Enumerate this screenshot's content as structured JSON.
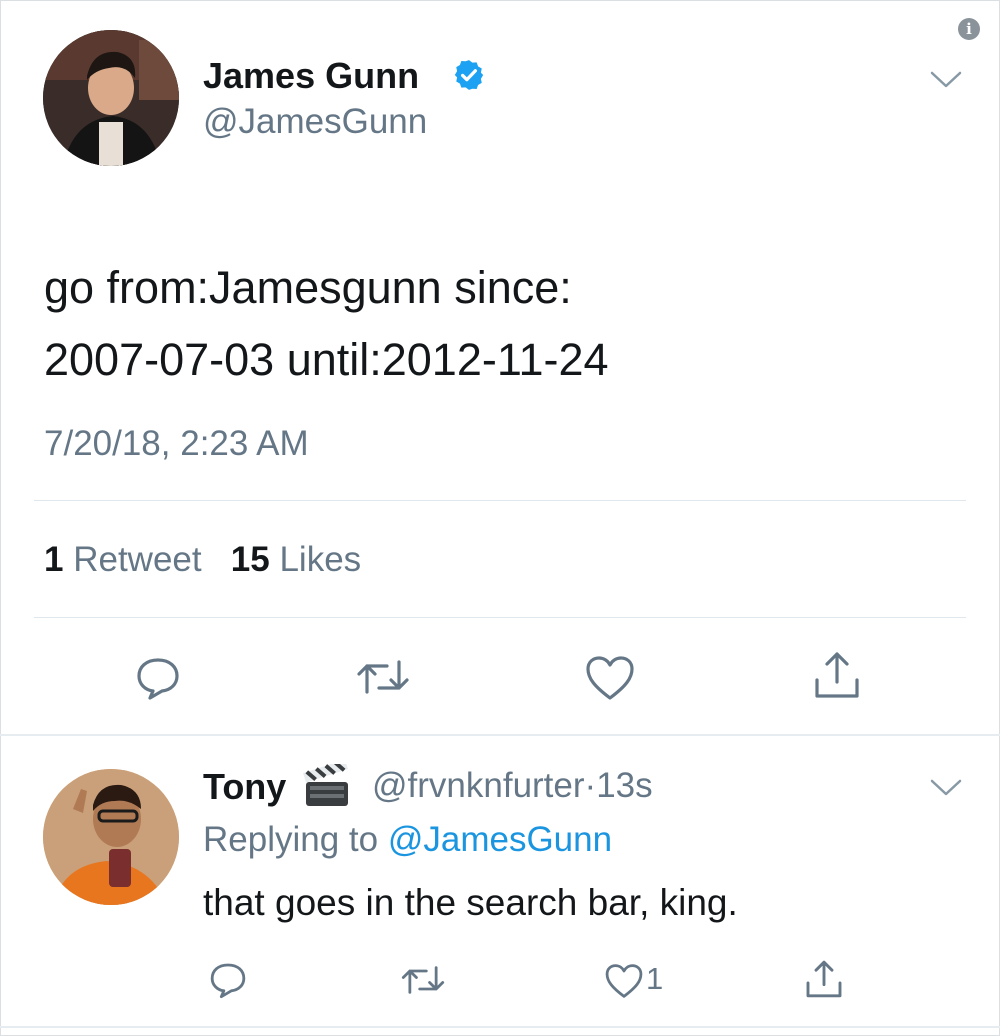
{
  "colors": {
    "text": "#14171a",
    "muted": "#657786",
    "link": "#1b95e0",
    "verified": "#1da1f2",
    "divider": "#e1e8ed"
  },
  "tweet": {
    "author_name": "James Gunn",
    "author_handle": "@JamesGunn",
    "text_line1": "go from:Jamesgunn since:",
    "text_line2": "2007-07-03 until:2012-11-24",
    "timestamp": "7/20/18, 2:23 AM",
    "retweet_count": "1",
    "retweet_label": "Retweet",
    "like_count": "15",
    "like_label": "Likes",
    "actions": [
      "reply-icon",
      "retweet-icon",
      "heart-icon",
      "share-icon"
    ]
  },
  "reply": {
    "author_name": "Tony",
    "emoji": "clapper-board-icon",
    "author_handle": "@frvnknfurter",
    "separator": "·",
    "age": "13s",
    "replying_prefix": "Replying to",
    "replying_handle": "@JamesGunn",
    "text": "that goes in the search bar, king.",
    "like_count": "1",
    "actions": [
      "reply-icon",
      "retweet-icon",
      "heart-icon",
      "share-icon"
    ]
  }
}
